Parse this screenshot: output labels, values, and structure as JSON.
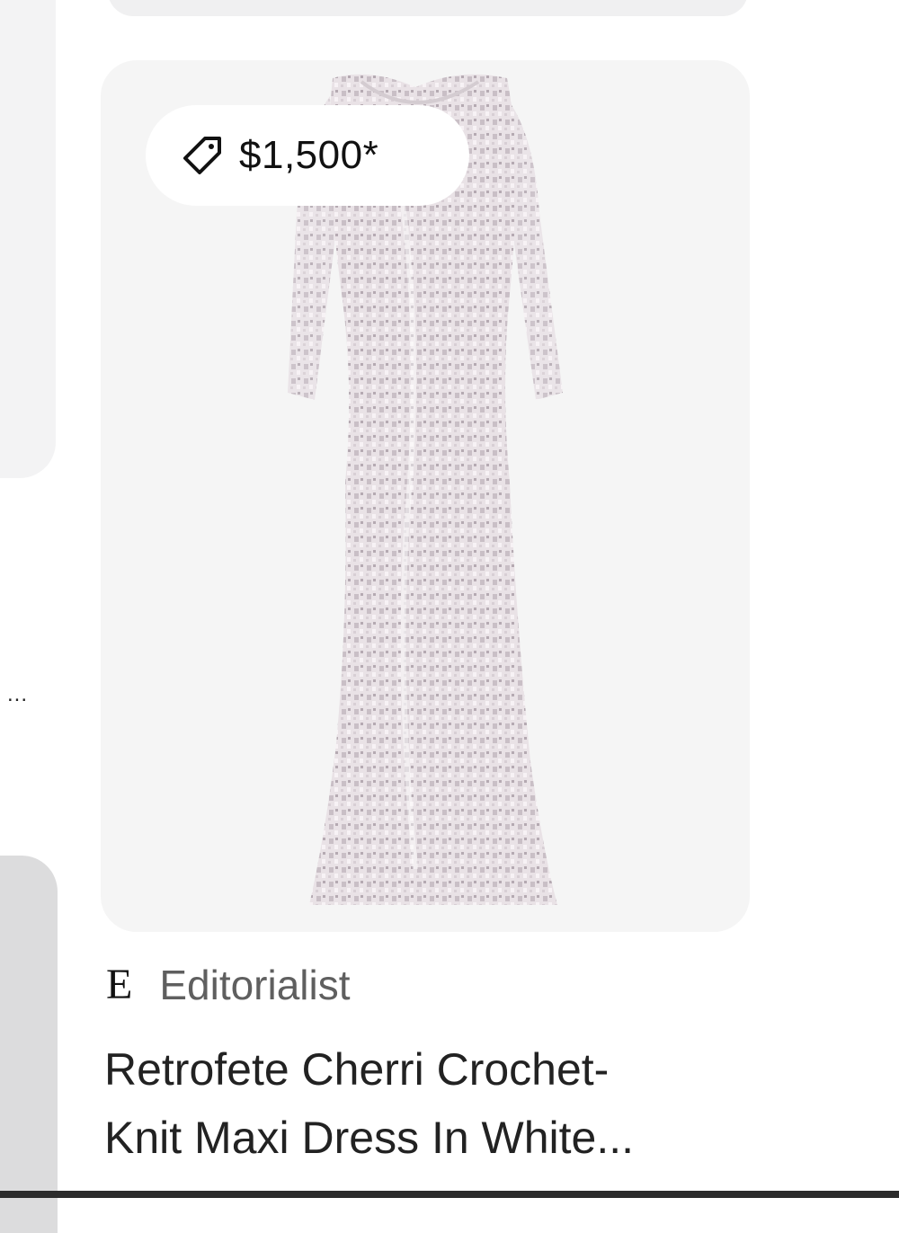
{
  "pin": {
    "price": "$1,500*",
    "source": {
      "logo_letter": "E",
      "name": "Editorialist"
    },
    "title_line1": "Retrofete Cherri Crochet-",
    "title_line2": "Knit Maxi Dress In White..."
  },
  "left_column": {
    "more_label": "..."
  },
  "icons": {
    "price": "price-tag-icon"
  }
}
